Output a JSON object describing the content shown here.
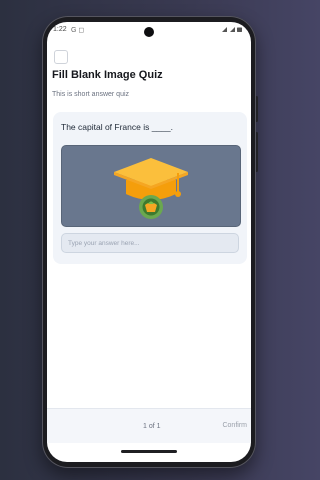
{
  "status": {
    "time": "1:22",
    "icons": "G ◻"
  },
  "header": {
    "menu_icon": "menu-icon",
    "title": "Fill Blank Image Quiz",
    "subtitle": "This is short answer quiz"
  },
  "question": {
    "text": "The capital of France is ____.",
    "image_icon": "graduation-cap-icon"
  },
  "answer": {
    "placeholder": "Type your answer here...",
    "value": ""
  },
  "footer": {
    "page_indicator": "1 of 1",
    "confirm_label": "Confirm"
  },
  "colors": {
    "image_background": "#69778e",
    "cap_top": "#fbbf3c",
    "cap_shadow": "#f59e0b",
    "badge_ring": "#6aa84f"
  }
}
